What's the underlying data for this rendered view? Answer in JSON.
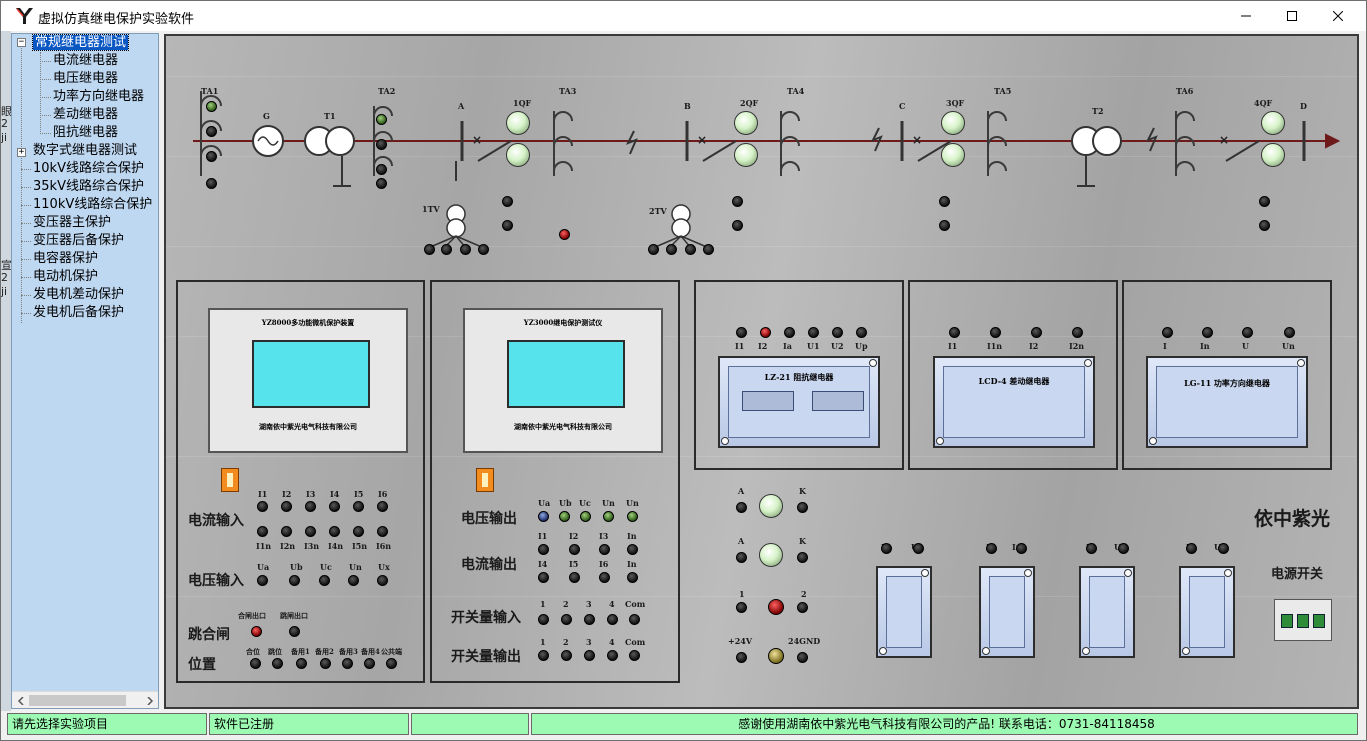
{
  "window": {
    "title": "虚拟仿真继电保护实验软件"
  },
  "tree": {
    "items": [
      {
        "label": "常规继电器测试",
        "selected": true,
        "expand": "−"
      },
      {
        "label": "电流继电器"
      },
      {
        "label": "电压继电器"
      },
      {
        "label": "功率方向继电器"
      },
      {
        "label": "差动继电器"
      },
      {
        "label": "阻抗继电器"
      },
      {
        "label": "数字式继电器测试",
        "expand": "+"
      },
      {
        "label": "10kV线路综合保护"
      },
      {
        "label": "35kV线路综合保护"
      },
      {
        "label": "110kV线路综合保护"
      },
      {
        "label": "变压器主保护"
      },
      {
        "label": "变压器后备保护"
      },
      {
        "label": "电容器保护"
      },
      {
        "label": "电动机保护"
      },
      {
        "label": "发电机差动保护"
      },
      {
        "label": "发电机后备保护"
      }
    ]
  },
  "diagram": {
    "labels": {
      "ta1": "TA1",
      "g": "G",
      "t1": "T1",
      "ta2": "TA2",
      "a": "A",
      "qf1": "1QF",
      "ta3": "TA3",
      "b": "B",
      "qf2": "2QF",
      "ta4": "TA4",
      "c": "C",
      "qf3": "3QF",
      "ta5": "TA5",
      "t2": "T2",
      "ta6": "TA6",
      "qf4": "4QF",
      "d": "D",
      "tv1": "1TV",
      "tv2": "2TV"
    }
  },
  "panel1": {
    "device_title": "YZ8000多功能微机保护装置",
    "device_footer": "湖南依中紫光电气科技有限公司",
    "current_input": "电流输入",
    "voltage_input": "电压输入",
    "trip_close": "跳合闸",
    "position": "位置",
    "current_terms_top": [
      "I1",
      "I2",
      "I3",
      "I4",
      "I5",
      "I6"
    ],
    "current_terms_bottom": [
      "I1n",
      "I2n",
      "I3n",
      "I4n",
      "I5n",
      "I6n"
    ],
    "voltage_terms": [
      "Ua",
      "Ub",
      "Uc",
      "Un",
      "Ux"
    ],
    "trip_terms": [
      "合闸出口",
      "跳闸出口"
    ],
    "position_terms": [
      "合位",
      "跳位",
      "备用1",
      "备用2",
      "备用3",
      "备用4",
      "公共端"
    ]
  },
  "panel2": {
    "device_title": "YZ3000继电保护测试仪",
    "device_footer": "湖南依中紫光电气科技有限公司",
    "voltage_output": "电压输出",
    "current_output": "电流输出",
    "switch_input": "开关量输入",
    "switch_output": "开关量输出",
    "v_out_terms": [
      "Ua",
      "Ub",
      "Uc",
      "Un"
    ],
    "i_out_top": [
      "I1",
      "I2",
      "I3",
      "In"
    ],
    "i_out_bottom": [
      "I4",
      "I5",
      "I6",
      "In"
    ],
    "switch_nums": [
      "1",
      "2",
      "3",
      "4",
      "Com"
    ]
  },
  "relays": {
    "impedance": {
      "name": "LZ-21 阻抗继电器",
      "terms": [
        "I1",
        "I2",
        "Ia",
        "U1",
        "U2",
        "Up"
      ]
    },
    "differential": {
      "name": "LCD-4 差动继电器",
      "terms": [
        "I1",
        "I1n",
        "I2",
        "I2n"
      ]
    },
    "power_dir": {
      "name": "LG-11 功率方向继电器",
      "terms": [
        "I",
        "In",
        "U",
        "Un"
      ]
    }
  },
  "controls": {
    "a_label": "A",
    "k_label": "K",
    "one": "1",
    "two": "2",
    "plus24": "+24V",
    "gnd": "24GND"
  },
  "brand": "依中紫光",
  "power_switch": "电源开关",
  "small_relay_terms": [
    [
      "U",
      "Un"
    ],
    [
      "I",
      "In"
    ],
    [
      "U",
      "Un"
    ],
    [
      "U",
      "Un"
    ]
  ],
  "statusbar": {
    "prompt": "请先选择实验项目",
    "registered": "软件已注册",
    "empty": "",
    "thanks": "感谢使用湖南依中紫光电气科技有限公司的产品!   联系电话：0731-84118458"
  }
}
